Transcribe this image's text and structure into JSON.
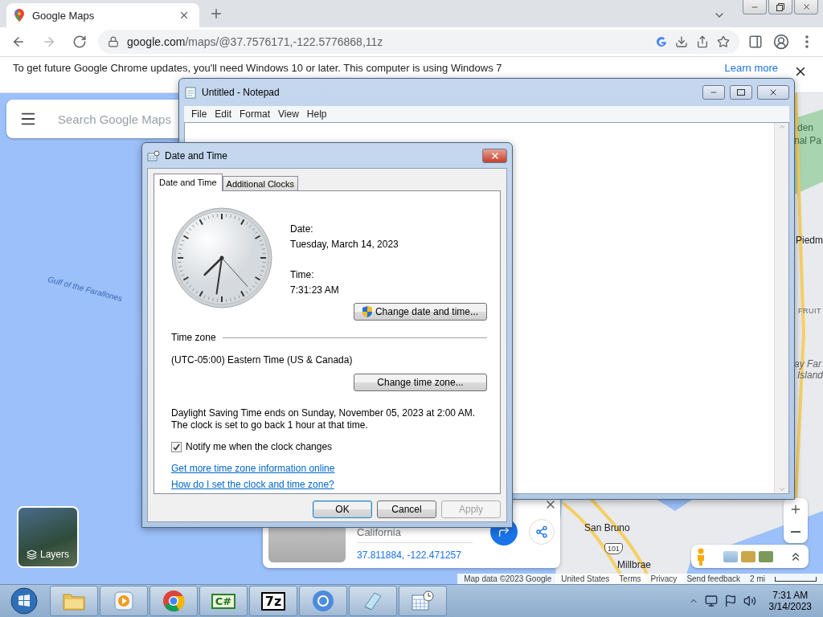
{
  "browser": {
    "tab_title": "Google Maps",
    "nav_buttons": [
      {
        "kind": "back",
        "disabled": false
      },
      {
        "kind": "forward",
        "disabled": true
      },
      {
        "kind": "reload",
        "disabled": false
      }
    ],
    "url_domain": "google.com",
    "url_path": "/maps/@37.7576171,-122.5776868,11z",
    "infobar": {
      "message": "To get future Google Chrome updates, you'll need Windows 10 or later. This computer is using Windows 7",
      "link": "Learn more"
    }
  },
  "map": {
    "search_placeholder": "Search Google Maps",
    "labels": [
      {
        "text": "Gulf of the Farallones",
        "kind": "water"
      },
      {
        "text": "den",
        "kind": "park"
      },
      {
        "text": "nal Pa",
        "kind": "park"
      },
      {
        "text": "Piedm",
        "kind": "city"
      },
      {
        "text": "FRUIT",
        "kind": "district"
      },
      {
        "text": "ay Far",
        "kind": "island"
      },
      {
        "text": "Island",
        "kind": "island"
      },
      {
        "text": "San Bruno",
        "kind": "city"
      },
      {
        "text": "101",
        "kind": "highway"
      },
      {
        "text": "Millbrae",
        "kind": "city"
      }
    ],
    "layers_label": "Layers",
    "place_card": {
      "title": "California",
      "coordinates": "37.811884, -122.471257"
    },
    "footer": [
      "Map data ©2023 Google",
      "United States",
      "Terms",
      "Privacy",
      "Send feedback"
    ],
    "scale": "2 mi"
  },
  "notepad": {
    "title": "Untitled - Notepad",
    "menu": [
      "File",
      "Edit",
      "Format",
      "View",
      "Help"
    ]
  },
  "dialog": {
    "title": "Date and Time",
    "tabs": [
      {
        "label": "Date and Time",
        "selected": true
      },
      {
        "label": "Additional Clocks",
        "selected": false
      }
    ],
    "date_label": "Date:",
    "date": "Tuesday, March 14, 2023",
    "time_label": "Time:",
    "time": "7:31:23 AM",
    "change_datetime_button": "Change date and time...",
    "timezone_heading": "Time zone",
    "timezone": "(UTC-05:00) Eastern Time (US & Canada)",
    "change_timezone_button": "Change time zone...",
    "dst_note": "Daylight Saving Time ends on Sunday, November 05, 2023 at 2:00 AM. The clock is set to go back 1 hour at that time.",
    "notify": {
      "label": "Notify me when the clock changes",
      "checked": true
    },
    "links": [
      "Get more time zone information online",
      "How do I set the clock and time zone?"
    ],
    "buttons": [
      {
        "label": "OK",
        "default": true,
        "disabled": false
      },
      {
        "label": "Cancel",
        "default": false,
        "disabled": false
      },
      {
        "label": "Apply",
        "default": false,
        "disabled": true
      }
    ]
  },
  "taskbar": {
    "apps": [
      {
        "kind": "folder"
      },
      {
        "kind": "media"
      },
      {
        "kind": "chrome"
      },
      {
        "kind": "csharp",
        "text": "C#"
      },
      {
        "kind": "archive",
        "text": "7z"
      },
      {
        "kind": "chromium"
      },
      {
        "kind": "notepad"
      },
      {
        "kind": "calendar"
      }
    ],
    "time": "7:31 AM",
    "date": "3/14/2023"
  }
}
